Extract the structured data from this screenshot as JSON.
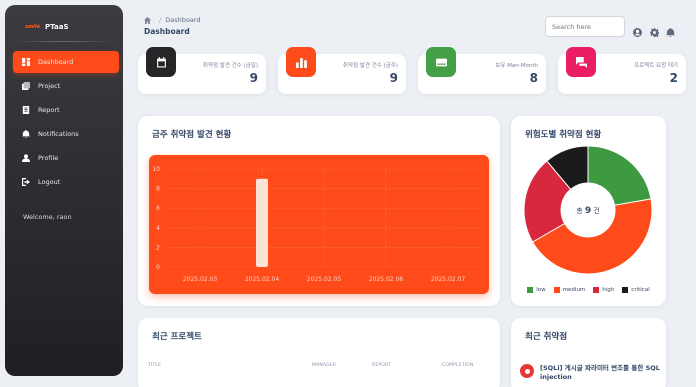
{
  "brand": {
    "logo_text": "ѕmile",
    "name": "PTaaS"
  },
  "sidebar": {
    "items": [
      {
        "label": "Dashboard",
        "icon": "dashboard-icon",
        "active": true
      },
      {
        "label": "Project",
        "icon": "project-icon",
        "active": false
      },
      {
        "label": "Report",
        "icon": "report-icon",
        "active": false
      },
      {
        "label": "Notifications",
        "icon": "bell-icon",
        "active": false
      },
      {
        "label": "Profile",
        "icon": "person-icon",
        "active": false
      },
      {
        "label": "Logout",
        "icon": "logout-icon",
        "active": false
      }
    ],
    "welcome": "Welcome, raon"
  },
  "header": {
    "breadcrumb_current": "Dashboard",
    "title": "Dashboard",
    "search_placeholder": "Search here"
  },
  "stats": [
    {
      "label": "취약점 발견 건수 (금일)",
      "value": "9",
      "color": "#262629",
      "icon": "calendar-icon"
    },
    {
      "label": "취약점 발견 건수 (금주)",
      "value": "9",
      "color": "#ff4a1a",
      "icon": "bar-chart-icon"
    },
    {
      "label": "보유 Man-Month",
      "value": "8",
      "color": "#43a047",
      "icon": "card-icon"
    },
    {
      "label": "프로젝트 요청 대기",
      "value": "2",
      "color": "#e91e63",
      "icon": "chat-icon"
    }
  ],
  "weekly_card": {
    "title": "금주 취약점 발견 현황"
  },
  "severity_card": {
    "title": "위험도별 취약점 현황",
    "center_prefix": "총",
    "center_value": "9",
    "center_suffix": "건"
  },
  "projects_card": {
    "title": "최근 프로젝트",
    "columns": [
      "TITLE",
      "MANAGER",
      "REPORT",
      "COMPLETION"
    ]
  },
  "vulns_card": {
    "title": "최근 취약점",
    "items": [
      {
        "text": "[SQLi] 게시글 파라미터 변조를 통한 SQL injection"
      }
    ]
  },
  "chart_data": [
    {
      "type": "bar",
      "categories": [
        "2025.02.03",
        "2025.02.04",
        "2025.02.05",
        "2025.02.06",
        "2025.02.07"
      ],
      "values": [
        0,
        9,
        0,
        0,
        0
      ],
      "ylim": [
        0,
        10
      ],
      "yticks": [
        0,
        2,
        4,
        6,
        8,
        10
      ],
      "bar_color": "#ffe2d6",
      "grid": true
    },
    {
      "type": "pie",
      "labels": [
        "low",
        "medium",
        "high",
        "critical"
      ],
      "values": [
        2,
        4,
        2,
        1
      ],
      "colors": [
        "#3d9a41",
        "#ff4a1a",
        "#d8283d",
        "#1b1b1b"
      ],
      "legend": "bottom"
    }
  ]
}
